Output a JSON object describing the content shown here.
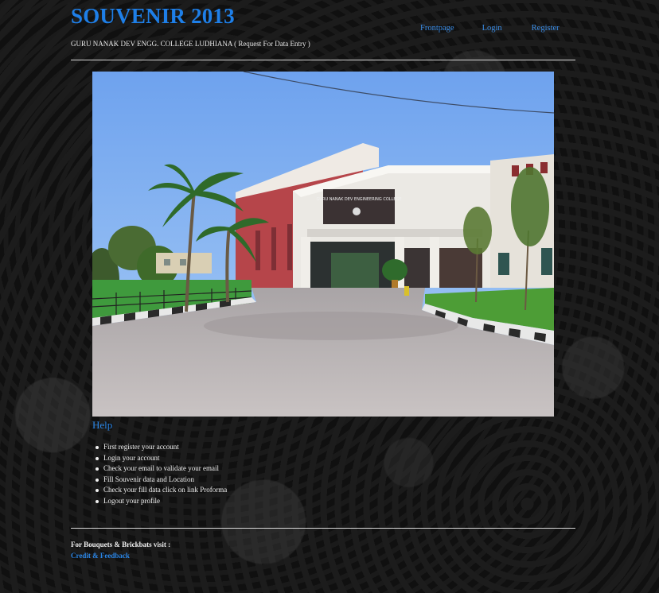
{
  "header": {
    "title": "SOUVENIR 2013",
    "subtitle": "GURU NANAK DEV ENGG. COLLEGE LUDHIANA ( Request For Data Entry )"
  },
  "nav": {
    "items": [
      {
        "label": "Frontpage"
      },
      {
        "label": "Login"
      },
      {
        "label": "Register"
      }
    ]
  },
  "photo": {
    "sign_text": "GURU NANAK DEV ENGINEERING COLLEGE"
  },
  "help": {
    "title": "Help",
    "items": [
      "First register your account",
      "Login your account",
      "Check your email to validate your email",
      "Fill Souvenir data and Location",
      "Check your fill data click on link Proforma",
      "Logout your profile"
    ]
  },
  "footer": {
    "text": "For Bouquets & Brickbats visit :",
    "link_label": "Credit & Feedback"
  },
  "colors": {
    "accent": "#1e7fe8",
    "link": "#3b8ee8",
    "background": "#111111"
  }
}
